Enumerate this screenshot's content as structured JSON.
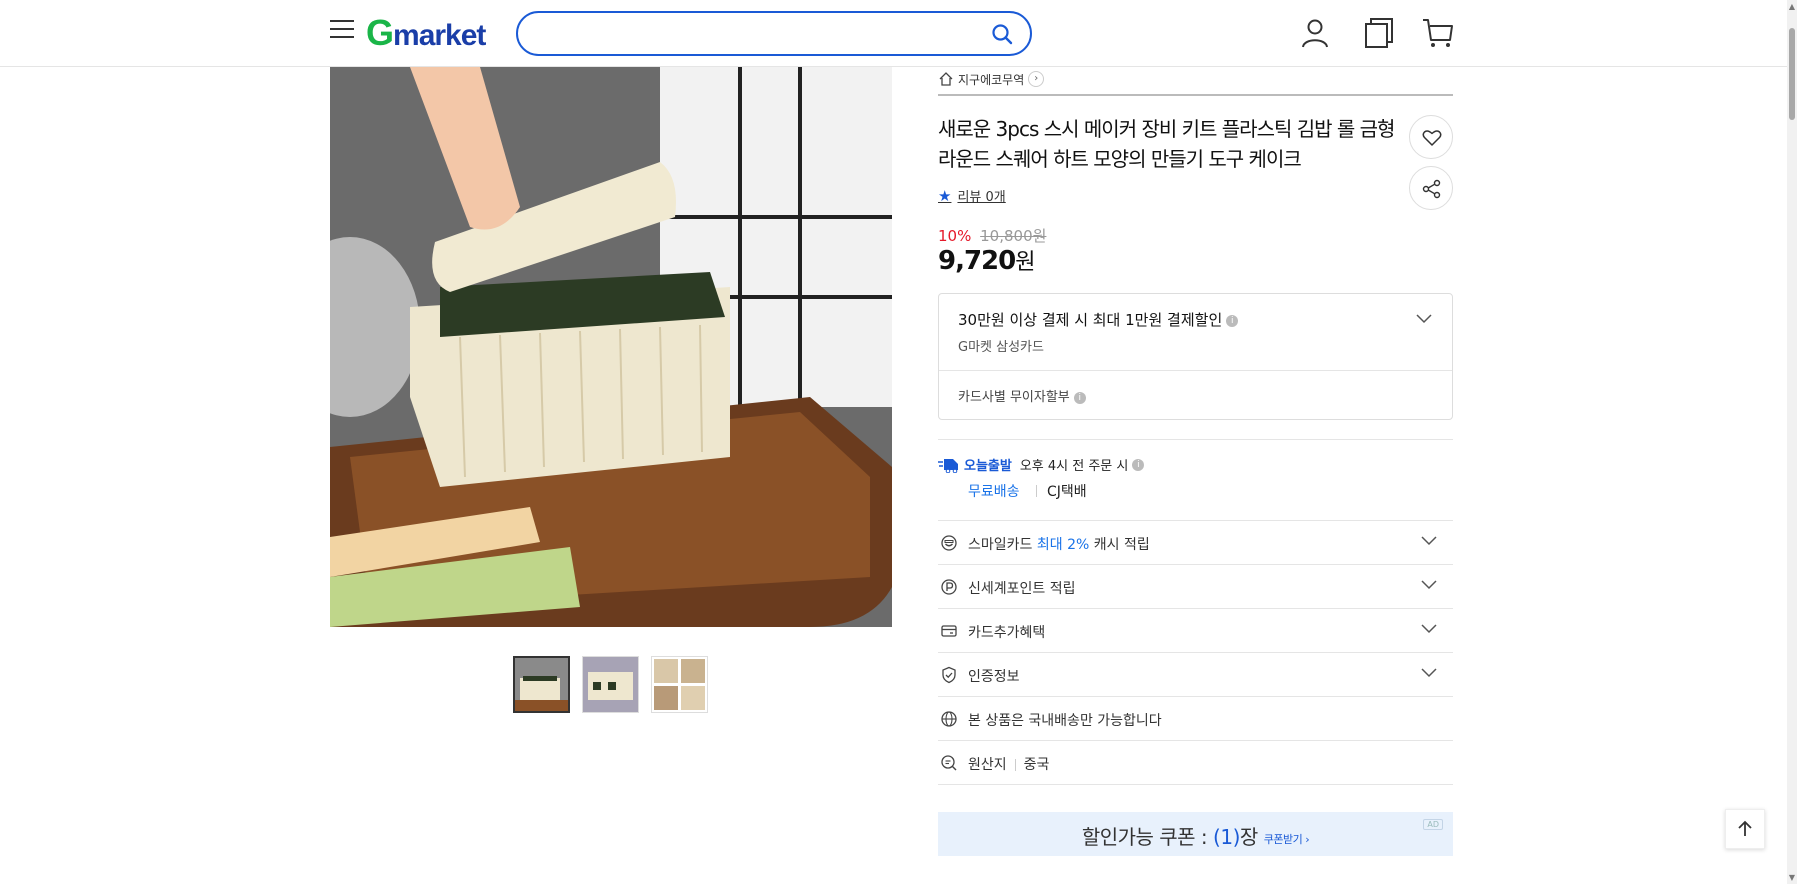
{
  "header": {
    "logo_g": "G",
    "logo_rest": "market",
    "search_placeholder": ""
  },
  "product": {
    "seller": "지구에코무역",
    "seller_chevron": "›",
    "title": "새로운 3pcs 스시 메이커 장비 키트 플라스틱 김밥 롤 금형 라운드 스퀘어 하트 모양의 만들기 도구 케이크",
    "review_label": "리뷰 0개",
    "discount_rate": "10%",
    "original_price": "10,800원",
    "price_number": "9,720",
    "price_unit": "원",
    "thumbnails_count": 3
  },
  "card_offer": {
    "title": "30만원 이상 결제 시 최대 1만원 결제할인",
    "subtitle": "G마켓 삼성카드",
    "installment": "카드사별 무이자할부"
  },
  "shipping": {
    "badge": "오늘출발",
    "cutoff": "오후 4시 전 주문 시",
    "free": "무료배송",
    "carrier": "CJ택배"
  },
  "benefits": [
    {
      "prefix": "스마일카드 ",
      "highlight": "최대 2%",
      "suffix": " 캐시 적립",
      "icon": "smile-icon"
    },
    {
      "prefix": "신세계포인트 적립",
      "highlight": "",
      "suffix": "",
      "icon": "point-icon"
    },
    {
      "prefix": "카드추가혜택",
      "highlight": "",
      "suffix": "",
      "icon": "card-icon"
    },
    {
      "prefix": "인증정보",
      "highlight": "",
      "suffix": "",
      "icon": "shield-check-icon"
    }
  ],
  "domestic_notice": "본 상품은 국내배송만 가능합니다",
  "origin": {
    "label": "원산지",
    "value": "중국"
  },
  "coupon": {
    "prefix": "할인가능 쿠폰 : ",
    "open_paren": "(",
    "count": "1",
    "close_paren": ")",
    "suffix": "장",
    "link": "쿠폰받기 ›",
    "ad": "AD"
  },
  "colors": {
    "accent_blue": "#1a5ad6",
    "discount_red": "#e5192a",
    "logo_green": "#1ab548",
    "logo_blue": "#1a3ea8"
  }
}
